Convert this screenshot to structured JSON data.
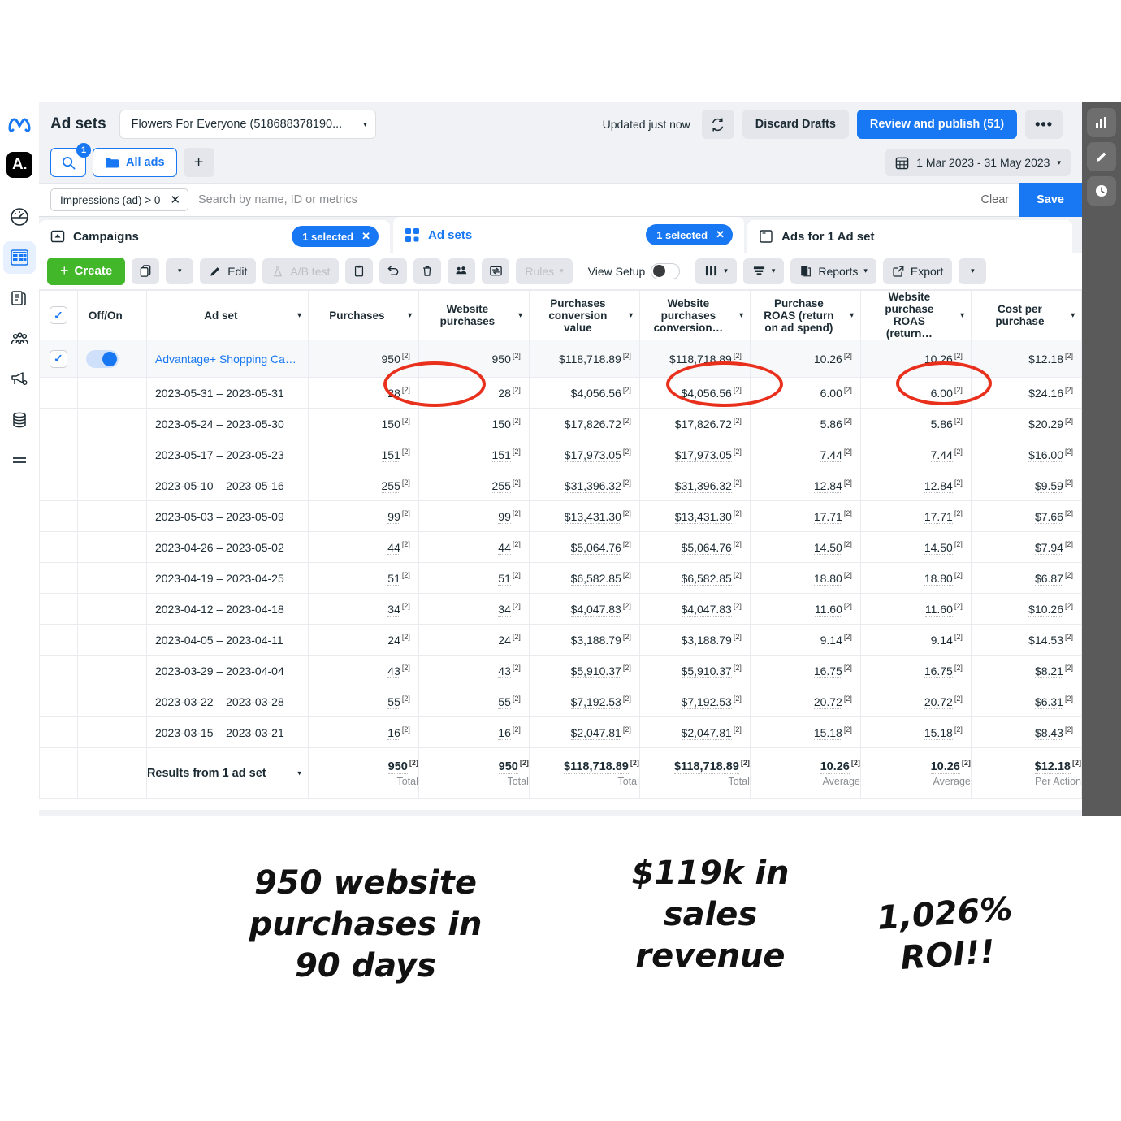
{
  "header": {
    "title": "Ad sets",
    "account_selector": "Flowers For Everyone (518688378190...",
    "updated": "Updated just now",
    "refresh_icon": "refresh-icon",
    "discard": "Discard Drafts",
    "review_publish": "Review and publish (51)",
    "more": "•••",
    "date_range": "1 Mar 2023 - 31 May 2023",
    "calendar_icon": "calendar-icon"
  },
  "search_row": {
    "search_icon": "search-icon",
    "search_badge": "1",
    "all_ads": "All ads",
    "folder_icon": "folder-icon",
    "add": "+"
  },
  "filter_bar": {
    "chip": "Impressions (ad) > 0",
    "chip_close": "✕",
    "placeholder": "Search by name, ID or metrics",
    "clear": "Clear",
    "save": "Save"
  },
  "tabs": [
    {
      "label": "Campaigns",
      "icon": "campaign-icon",
      "pill": "1 selected",
      "pill_close": "✕"
    },
    {
      "label": "Ad sets",
      "icon": "adsets-icon",
      "pill": "1 selected",
      "pill_close": "✕"
    },
    {
      "label": "Ads for 1 Ad set",
      "icon": "ads-icon",
      "pill": "",
      "pill_close": ""
    }
  ],
  "toolbar": {
    "create": "Create",
    "create_icon": "plus-icon",
    "duplicate_icon": "duplicate-icon",
    "duplicate_caret": "▾",
    "edit": "Edit",
    "edit_icon": "pencil-icon",
    "ab_test": "A/B test",
    "ab_icon": "flask-icon",
    "clipboard_icon": "clipboard-icon",
    "undo_icon": "undo-icon",
    "delete_icon": "trash-icon",
    "audience_icon": "audience-icon",
    "transfer_icon": "transfer-icon",
    "rules": "Rules",
    "rules_caret": "▾",
    "view_setup": "View Setup",
    "columns_icon": "columns-icon",
    "columns_caret": "▾",
    "breakdown_icon": "breakdown-icon",
    "breakdown_caret": "▾",
    "reports": "Reports",
    "reports_icon": "reports-icon",
    "reports_caret": "▾",
    "export": "Export",
    "export_icon": "export-icon",
    "export_caret": "▾"
  },
  "table": {
    "columns": [
      "Off/On",
      "Ad set",
      "Purchases",
      "Website purchases",
      "Purchases conversion value",
      "Website purchases conversion…",
      "Purchase ROAS (return on ad spend)",
      "Website purchase ROAS (return…",
      "Cost per purchase"
    ],
    "superscript": "[2]",
    "rows": [
      {
        "name": "Advantage+ Shopping Ca…",
        "is_campaign": true,
        "purchases": "950",
        "website_purchases": "950",
        "conv_value": "$118,718.89",
        "web_conv_value": "$118,718.89",
        "roas": "10.26",
        "web_roas": "10.26",
        "cpp": "$12.18"
      },
      {
        "name": "2023-05-31 – 2023-05-31",
        "is_campaign": false,
        "purchases": "28",
        "website_purchases": "28",
        "conv_value": "$4,056.56",
        "web_conv_value": "$4,056.56",
        "roas": "6.00",
        "web_roas": "6.00",
        "cpp": "$24.16"
      },
      {
        "name": "2023-05-24 – 2023-05-30",
        "is_campaign": false,
        "purchases": "150",
        "website_purchases": "150",
        "conv_value": "$17,826.72",
        "web_conv_value": "$17,826.72",
        "roas": "5.86",
        "web_roas": "5.86",
        "cpp": "$20.29"
      },
      {
        "name": "2023-05-17 – 2023-05-23",
        "is_campaign": false,
        "purchases": "151",
        "website_purchases": "151",
        "conv_value": "$17,973.05",
        "web_conv_value": "$17,973.05",
        "roas": "7.44",
        "web_roas": "7.44",
        "cpp": "$16.00"
      },
      {
        "name": "2023-05-10 – 2023-05-16",
        "is_campaign": false,
        "purchases": "255",
        "website_purchases": "255",
        "conv_value": "$31,396.32",
        "web_conv_value": "$31,396.32",
        "roas": "12.84",
        "web_roas": "12.84",
        "cpp": "$9.59"
      },
      {
        "name": "2023-05-03 – 2023-05-09",
        "is_campaign": false,
        "purchases": "99",
        "website_purchases": "99",
        "conv_value": "$13,431.30",
        "web_conv_value": "$13,431.30",
        "roas": "17.71",
        "web_roas": "17.71",
        "cpp": "$7.66"
      },
      {
        "name": "2023-04-26 – 2023-05-02",
        "is_campaign": false,
        "purchases": "44",
        "website_purchases": "44",
        "conv_value": "$5,064.76",
        "web_conv_value": "$5,064.76",
        "roas": "14.50",
        "web_roas": "14.50",
        "cpp": "$7.94"
      },
      {
        "name": "2023-04-19 – 2023-04-25",
        "is_campaign": false,
        "purchases": "51",
        "website_purchases": "51",
        "conv_value": "$6,582.85",
        "web_conv_value": "$6,582.85",
        "roas": "18.80",
        "web_roas": "18.80",
        "cpp": "$6.87"
      },
      {
        "name": "2023-04-12 – 2023-04-18",
        "is_campaign": false,
        "purchases": "34",
        "website_purchases": "34",
        "conv_value": "$4,047.83",
        "web_conv_value": "$4,047.83",
        "roas": "11.60",
        "web_roas": "11.60",
        "cpp": "$10.26"
      },
      {
        "name": "2023-04-05 – 2023-04-11",
        "is_campaign": false,
        "purchases": "24",
        "website_purchases": "24",
        "conv_value": "$3,188.79",
        "web_conv_value": "$3,188.79",
        "roas": "9.14",
        "web_roas": "9.14",
        "cpp": "$14.53"
      },
      {
        "name": "2023-03-29 – 2023-04-04",
        "is_campaign": false,
        "purchases": "43",
        "website_purchases": "43",
        "conv_value": "$5,910.37",
        "web_conv_value": "$5,910.37",
        "roas": "16.75",
        "web_roas": "16.75",
        "cpp": "$8.21"
      },
      {
        "name": "2023-03-22 – 2023-03-28",
        "is_campaign": false,
        "purchases": "55",
        "website_purchases": "55",
        "conv_value": "$7,192.53",
        "web_conv_value": "$7,192.53",
        "roas": "20.72",
        "web_roas": "20.72",
        "cpp": "$6.31"
      },
      {
        "name": "2023-03-15 – 2023-03-21",
        "is_campaign": false,
        "purchases": "16",
        "website_purchases": "16",
        "conv_value": "$2,047.81",
        "web_conv_value": "$2,047.81",
        "roas": "15.18",
        "web_roas": "15.18",
        "cpp": "$8.43"
      }
    ],
    "totals": {
      "label": "Results from 1 ad set",
      "purchases": {
        "value": "950",
        "kind": "Total"
      },
      "website_purchases": {
        "value": "950",
        "kind": "Total"
      },
      "conv_value": {
        "value": "$118,718.89",
        "kind": "Total"
      },
      "web_conv_value": {
        "value": "$118,718.89",
        "kind": "Total"
      },
      "roas": {
        "value": "10.26",
        "kind": "Average"
      },
      "web_roas": {
        "value": "10.26",
        "kind": "Average"
      },
      "cpp": {
        "value": "$12.18",
        "kind": "Per Action"
      }
    }
  },
  "annotations": {
    "note1": "950 website purchases in 90 days",
    "note2": "$119k in sales revenue",
    "note3": "1,026% ROI!!",
    "highlight_color": "#e8301c"
  },
  "left_rail": [
    {
      "name": "meta-logo-icon"
    },
    {
      "name": "account-badge-icon",
      "label": "A."
    },
    {
      "name": "gauge-icon"
    },
    {
      "name": "table-icon"
    },
    {
      "name": "pages-icon"
    },
    {
      "name": "audiences-icon"
    },
    {
      "name": "megaphone-icon"
    },
    {
      "name": "billing-icon"
    },
    {
      "name": "menu-icon"
    }
  ],
  "right_rail": [
    {
      "name": "chart-icon"
    },
    {
      "name": "pencil-icon"
    },
    {
      "name": "clock-icon"
    }
  ]
}
